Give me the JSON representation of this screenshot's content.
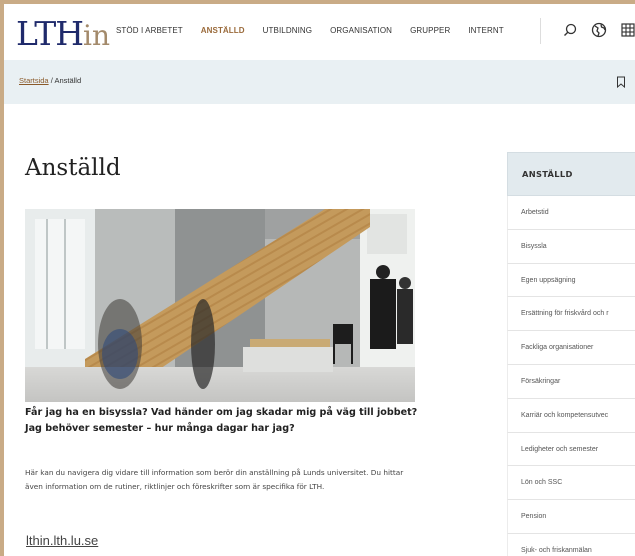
{
  "header": {
    "logo_main": "LTH",
    "logo_suffix": "in",
    "nav": [
      {
        "label": "STÖD I ARBETET"
      },
      {
        "label": "ANSTÄLLD"
      },
      {
        "label": "UTBILDNING"
      },
      {
        "label": "ORGANISATION"
      },
      {
        "label": "GRUPPER"
      },
      {
        "label": "INTERNT"
      }
    ],
    "active_nav": "ANSTÄLLD",
    "icons": [
      "search-icon",
      "language-globe-icon",
      "apps-grid-icon"
    ]
  },
  "breadcrumb": {
    "home": "Startsida",
    "separator": " / ",
    "current": "Anställd"
  },
  "main": {
    "title": "Anställd",
    "lead": "Får jag ha en bisyssla? Vad händer om jag skadar mig på väg till jobbet? Jag behöver semester – hur många dagar har jag?",
    "body": "Här kan du navigera dig vidare till information som berör din anställning på Lunds universitet. Du hittar även information om de rutiner, riktlinjer och föreskrifter som är specifika för LTH.",
    "domain": "lthin.lth.lu.se"
  },
  "sidebar": {
    "heading": "ANSTÄLLD",
    "items": [
      {
        "label": "Arbetstid"
      },
      {
        "label": "Bisyssla"
      },
      {
        "label": "Egen uppsägning"
      },
      {
        "label": "Ersättning för friskvård och r"
      },
      {
        "label": "Fackliga organisationer"
      },
      {
        "label": "Försäkringar"
      },
      {
        "label": "Karriär och kompetensutvec"
      },
      {
        "label": "Ledigheter och semester"
      },
      {
        "label": "Lön och SSC"
      },
      {
        "label": "Pension"
      },
      {
        "label": "Sjuk- och friskanmälan"
      }
    ]
  },
  "colors": {
    "logo_blue": "#1f2a6b",
    "accent_bronze": "#9a6a3a",
    "breadcrumb_bg": "#e9f0f3",
    "page_border": "#c9ab86"
  }
}
